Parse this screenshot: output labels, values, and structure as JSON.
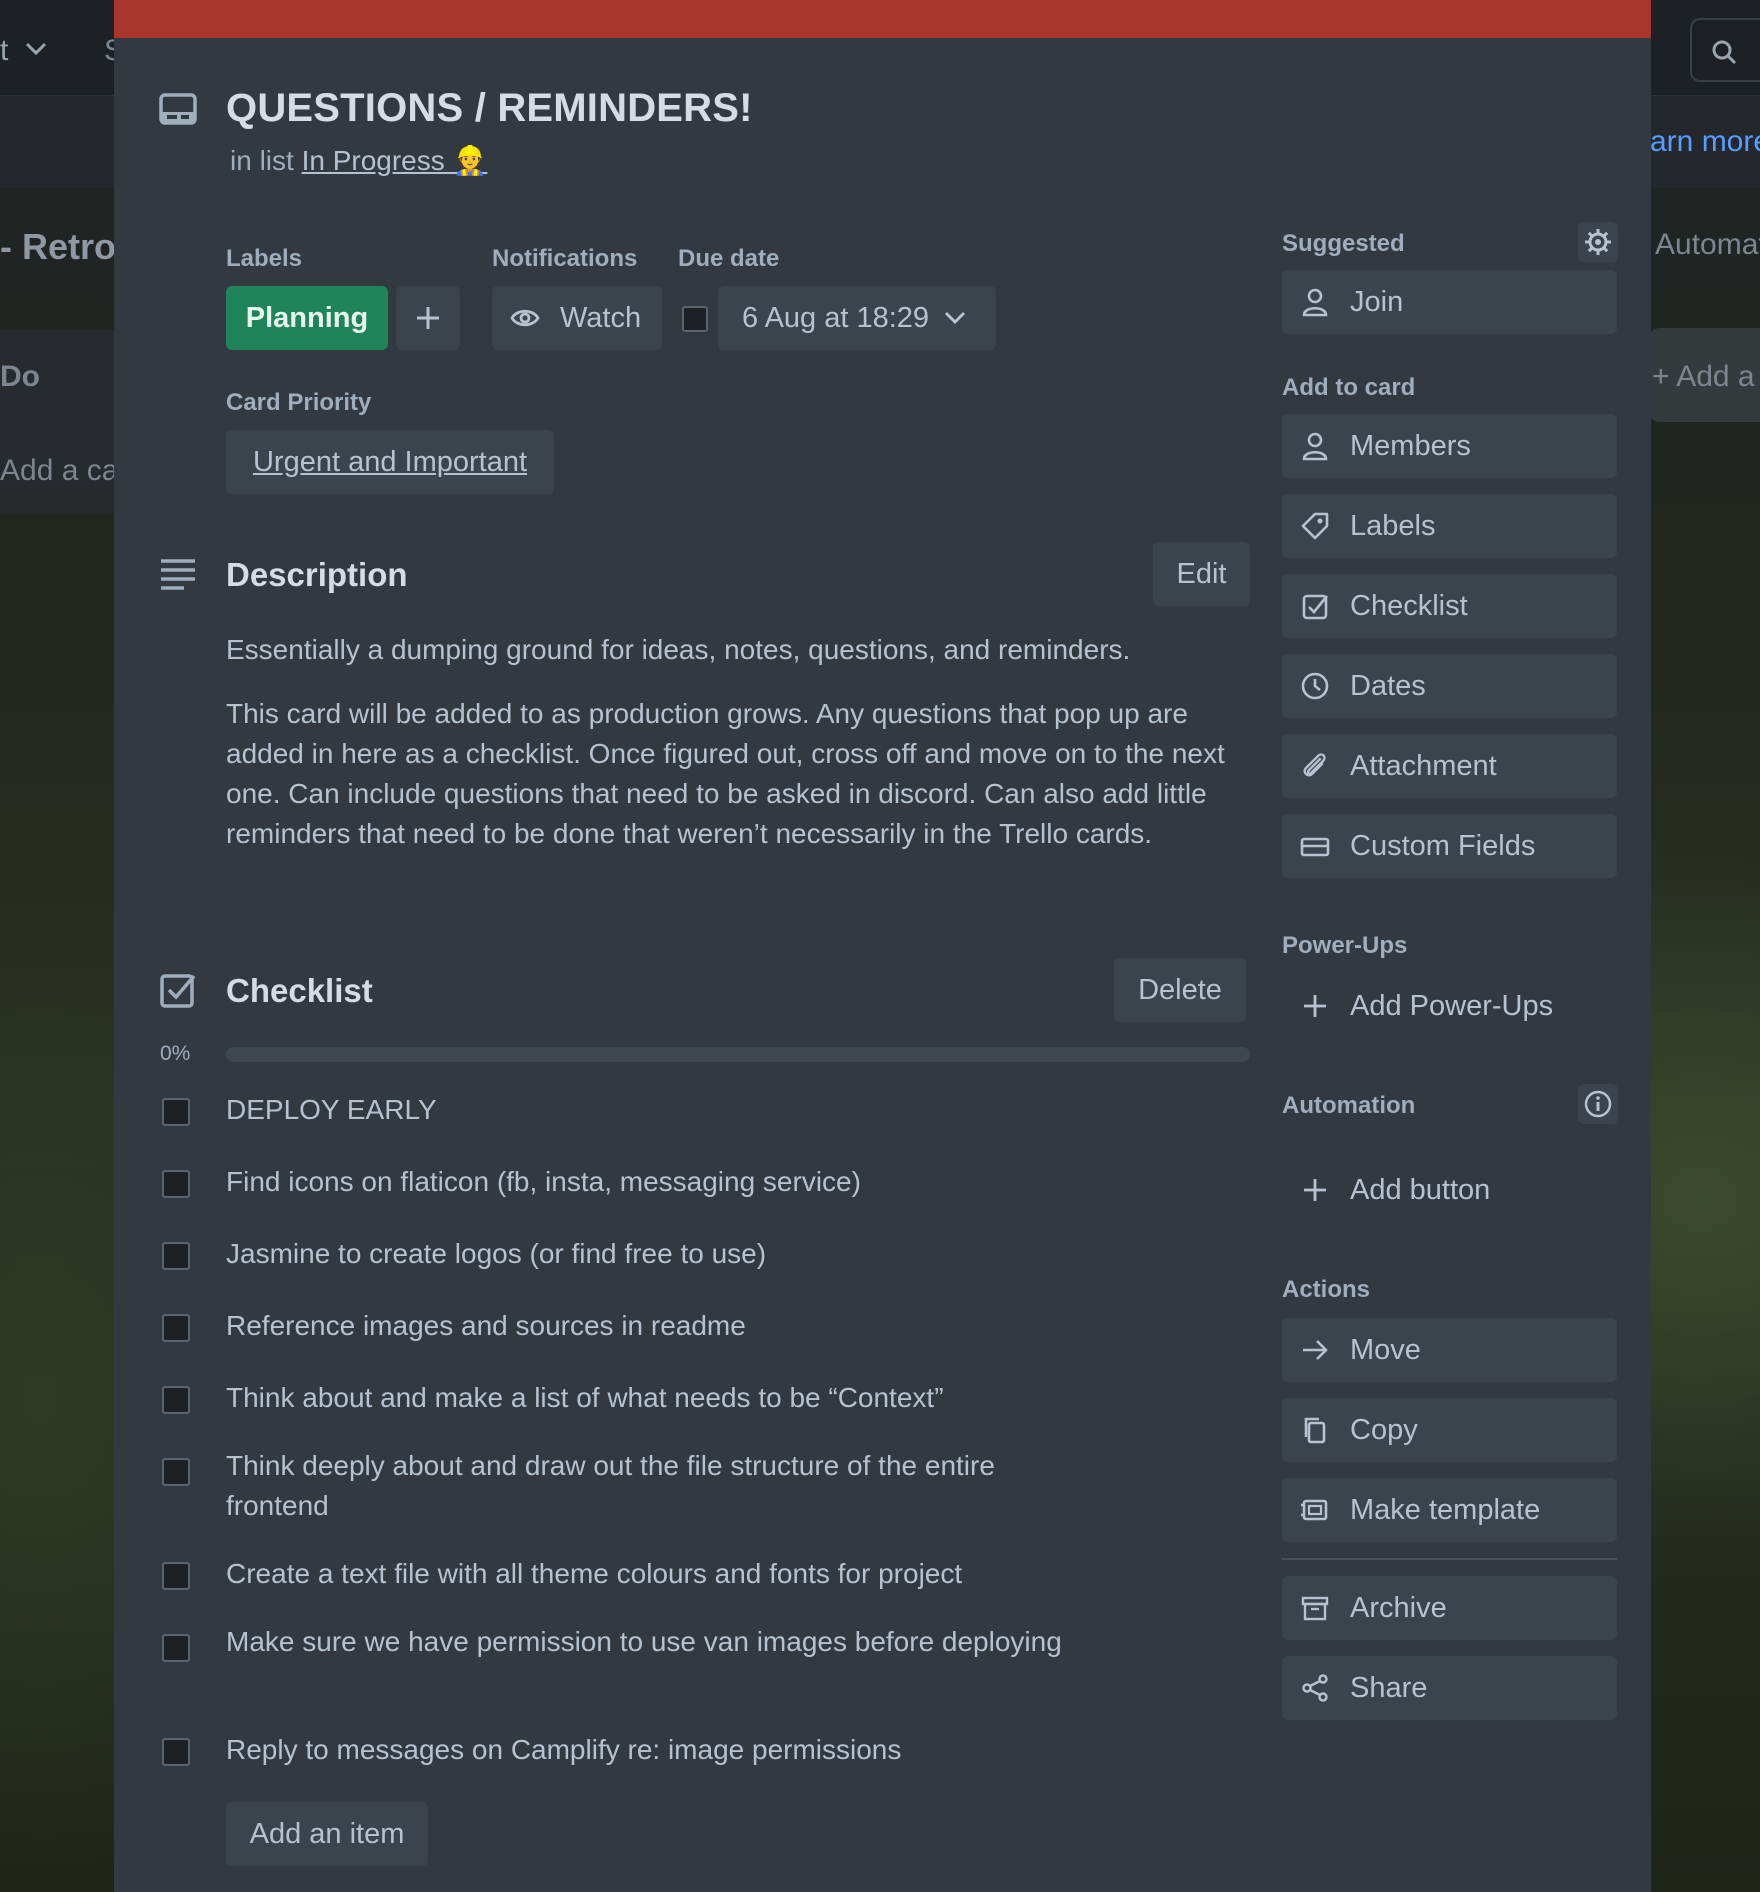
{
  "background": {
    "top_left_text": "t",
    "top_s_text": "S",
    "board_left_title": "- Retro",
    "board_right_title": "arn more",
    "board_right_button": "Automat",
    "list_left_title": "Do",
    "list_left_add": "Add a car",
    "list_right_add": "+ Add a"
  },
  "card": {
    "title": "QUESTIONS / REMINDERS!",
    "in_list_prefix": "in list",
    "list_name": "In Progress 👷",
    "cover_color": "#a9362b"
  },
  "labels": {
    "heading": "Labels",
    "items": [
      {
        "name": "Planning",
        "color": "#1f845a"
      }
    ],
    "add_icon": "plus-icon"
  },
  "notifications": {
    "heading": "Notifications",
    "watch_label": "Watch",
    "watch_icon": "eye-icon"
  },
  "due_date": {
    "heading": "Due date",
    "value": "6 Aug at 18:29",
    "checked": false
  },
  "priority": {
    "heading": "Card Priority",
    "value": "Urgent and Important"
  },
  "description": {
    "heading": "Description",
    "edit_label": "Edit",
    "paragraph1": "Essentially a dumping ground for ideas, notes, questions, and reminders.",
    "paragraph2": "This card will be added to as production grows. Any questions that pop up are added in here as a checklist. Once figured out, cross off and move on to the next one. Can include questions that need to be asked in discord. Can also add little reminders that need to be done that weren’t necessarily in the Trello cards."
  },
  "checklist": {
    "heading": "Checklist",
    "delete_label": "Delete",
    "progress_text": "0%",
    "progress": 0,
    "items": [
      {
        "text": "DEPLOY EARLY",
        "checked": false
      },
      {
        "text": "Find icons on flaticon (fb, insta, messaging service)",
        "checked": false
      },
      {
        "text": "Jasmine to create logos (or find free to use)",
        "checked": false
      },
      {
        "text": "Reference images and sources in readme",
        "checked": false
      },
      {
        "text": "Think about and make a list of what needs to be “Context”",
        "checked": false
      },
      {
        "text": "Think deeply about and draw out the file structure of the entire frontend",
        "checked": false
      },
      {
        "text": "Create a text file with all theme colours and fonts for project",
        "checked": false
      },
      {
        "text": "Make sure we have permission to use van images before deploying",
        "checked": false
      },
      {
        "text": "Reply to messages on Camplify re: image permissions",
        "checked": false
      }
    ],
    "add_item_label": "Add an item"
  },
  "sidebar": {
    "suggested": {
      "heading": "Suggested",
      "settings_icon": "gear-icon",
      "join_label": "Join"
    },
    "add_to_card": {
      "heading": "Add to card",
      "items": [
        {
          "label": "Members",
          "icon": "person-icon"
        },
        {
          "label": "Labels",
          "icon": "tag-icon"
        },
        {
          "label": "Checklist",
          "icon": "checkbox-icon"
        },
        {
          "label": "Dates",
          "icon": "clock-icon"
        },
        {
          "label": "Attachment",
          "icon": "paperclip-icon"
        },
        {
          "label": "Custom Fields",
          "icon": "fields-icon"
        }
      ]
    },
    "power_ups": {
      "heading": "Power-Ups",
      "add_label": "Add Power-Ups"
    },
    "automation": {
      "heading": "Automation",
      "info_icon": "info-icon",
      "add_label": "Add button"
    },
    "actions": {
      "heading": "Actions",
      "items": [
        {
          "label": "Move",
          "icon": "arrow-right-icon"
        },
        {
          "label": "Copy",
          "icon": "copy-icon"
        },
        {
          "label": "Make template",
          "icon": "template-icon"
        },
        {
          "label": "Archive",
          "icon": "archive-icon"
        },
        {
          "label": "Share",
          "icon": "share-icon"
        }
      ]
    }
  }
}
